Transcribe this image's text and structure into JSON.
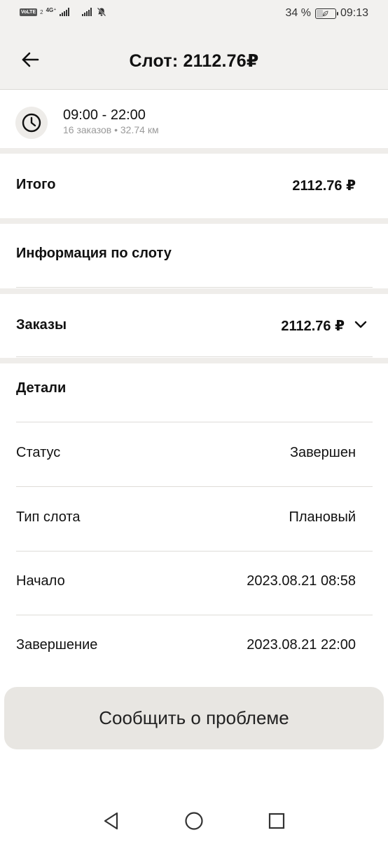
{
  "status_bar": {
    "volte": "VoLTE",
    "sim_number": "2",
    "network": "4G⁺",
    "battery_percent": "34 %",
    "battery_level": 0.34,
    "time": "09:13",
    "icons": [
      "volte-icon",
      "signal-icon",
      "signal-icon",
      "bell-off-icon",
      "battery-icon"
    ]
  },
  "header": {
    "title": "Слот: 2112.76₽",
    "back_icon": "arrow-left-icon"
  },
  "slot": {
    "time_range": "09:00 - 22:00",
    "subtitle": "16 заказов • 32.74 км",
    "icon": "clock-icon"
  },
  "total": {
    "label": "Итого",
    "value": "2112.76 ₽"
  },
  "slot_info": {
    "label": "Информация по слоту"
  },
  "orders": {
    "label": "Заказы",
    "value": "2112.76 ₽",
    "icon": "chevron-down-icon"
  },
  "details": {
    "title": "Детали",
    "rows": [
      {
        "label": "Статус",
        "value": "Завершен"
      },
      {
        "label": "Тип слота",
        "value": "Плановый"
      },
      {
        "label": "Начало",
        "value": "2023.08.21 08:58"
      },
      {
        "label": "Завершение",
        "value": "2023.08.21 22:00"
      }
    ]
  },
  "report_button": {
    "label": "Сообщить о проблеме"
  },
  "navbar": {
    "icons": [
      "nav-back-icon",
      "nav-home-icon",
      "nav-recent-icon"
    ]
  },
  "colors": {
    "header_bg": "#f2f1ef",
    "separator": "#efedea",
    "button_bg": "#e8e6e2",
    "muted_text": "#9a9a9a"
  }
}
